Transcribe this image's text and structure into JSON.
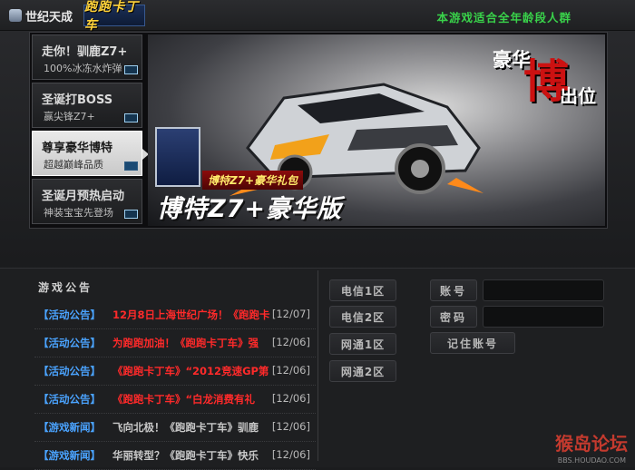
{
  "header": {
    "brand": "世纪天成",
    "game_logo": "跑跑卡丁车",
    "age_note": "本游戏适合全年龄段人群"
  },
  "banner": {
    "tabs": [
      {
        "title": "走你！驯鹿Z7+",
        "subtitle": "100%冰冻水炸弹"
      },
      {
        "title": "圣诞打BOSS",
        "subtitle": "赢尖锋Z7+"
      },
      {
        "title": "尊享豪华博特",
        "subtitle": "超越巅峰品质"
      },
      {
        "title": "圣诞月预热启动",
        "subtitle": "神装宝宝先登场"
      }
    ],
    "headline_left": "豪华",
    "headline_big": "博",
    "headline_right": "出位",
    "gift_label": "博特Z7+豪华礼包",
    "main_title": "博特Z7+豪华版"
  },
  "notices": {
    "title": "游戏公告",
    "items": [
      {
        "category": "【活动公告】",
        "text": "12月8日上海世纪广场！《跑跑卡",
        "date": "[12/07]",
        "color": "red"
      },
      {
        "category": "【活动公告】",
        "text": "为跑跑加油！《跑跑卡丁车》强",
        "date": "[12/06]",
        "color": "red"
      },
      {
        "category": "【活动公告】",
        "text": "《跑跑卡丁车》“2012竞速GP第",
        "date": "[12/06]",
        "color": "red"
      },
      {
        "category": "【活动公告】",
        "text": "《跑跑卡丁车》“白龙消费有礼",
        "date": "[12/06]",
        "color": "red"
      },
      {
        "category": "【游戏新闻】",
        "text": "飞向北极！《跑跑卡丁车》驯鹿",
        "date": "[12/06]",
        "color": "gray"
      },
      {
        "category": "【游戏新闻】",
        "text": "华丽转型？《跑跑卡丁车》快乐",
        "date": "[12/06]",
        "color": "gray"
      }
    ]
  },
  "servers": [
    "电信1区",
    "电信2区",
    "网通1区",
    "网通2区"
  ],
  "login": {
    "account_label": "账号",
    "password_label": "密码",
    "remember_label": "记住账号",
    "account_value": "",
    "password_value": ""
  },
  "watermark": {
    "text": "猴岛论坛",
    "sub": "BBS.HOUDAO.COM"
  }
}
